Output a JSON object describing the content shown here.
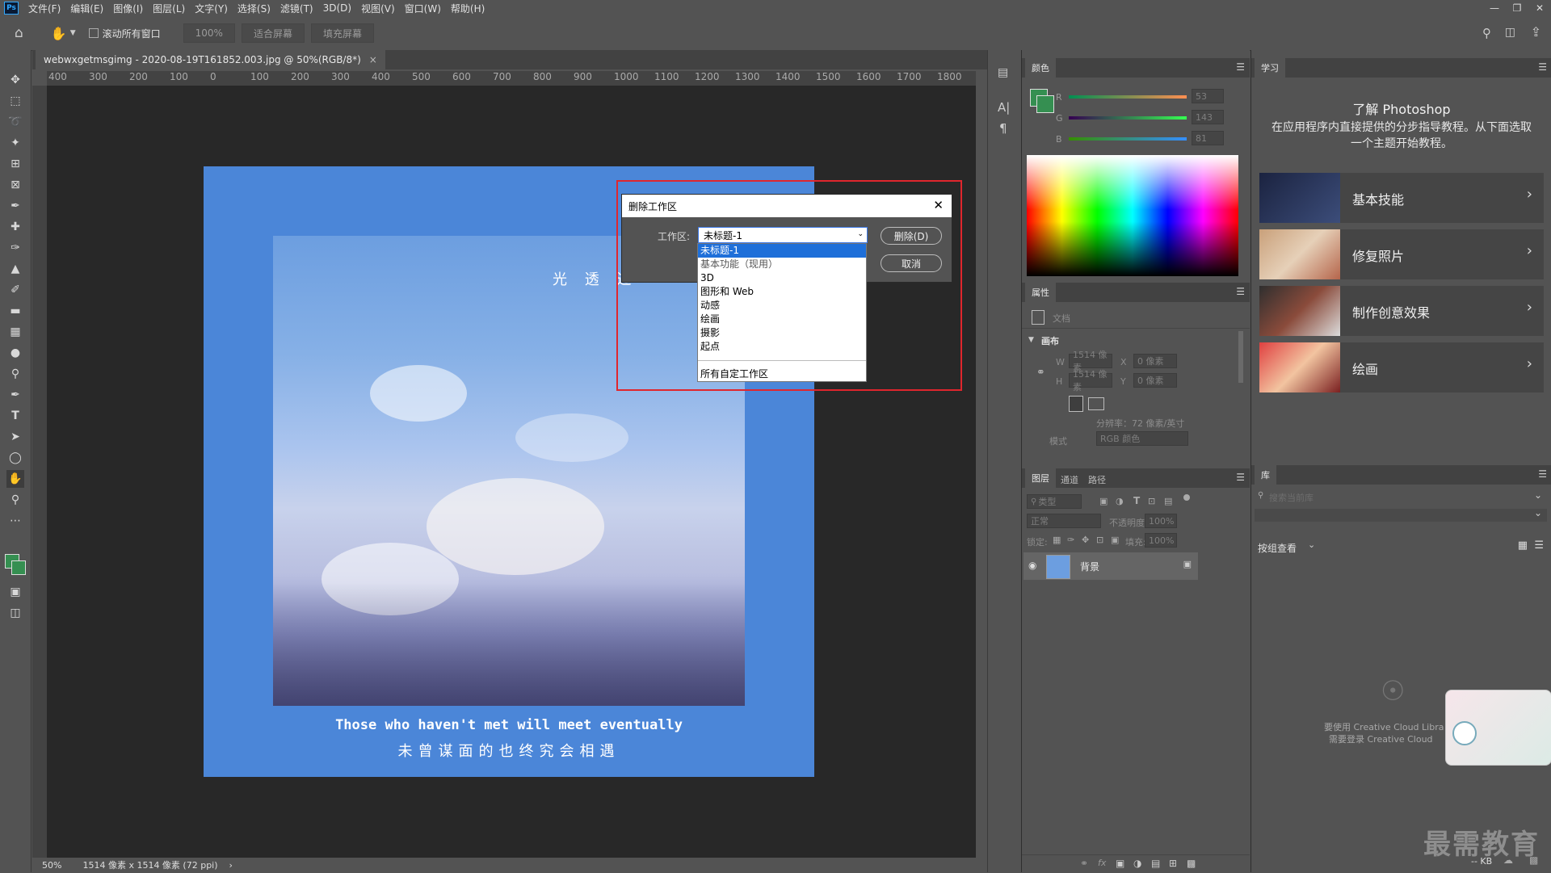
{
  "menu": {
    "items": [
      "文件(F)",
      "编辑(E)",
      "图像(I)",
      "图层(L)",
      "文字(Y)",
      "选择(S)",
      "滤镜(T)",
      "3D(D)",
      "视图(V)",
      "窗口(W)",
      "帮助(H)"
    ]
  },
  "app": {
    "logo": "Ps"
  },
  "options": {
    "scroll_all": "滚动所有窗口",
    "zoom_100": "100%",
    "fit_screen": "适合屏幕",
    "fill_screen": "填充屏幕"
  },
  "document": {
    "tab_title": "webwxgetmsgimg - 2020-08-19T161852.003.jpg @ 50%(RGB/8*)",
    "tab_close": "×"
  },
  "ruler": {
    "h_ticks": [
      "400",
      "300",
      "200",
      "100",
      "0",
      "100",
      "200",
      "300",
      "400",
      "500",
      "600",
      "700",
      "800",
      "900",
      "1000",
      "1100",
      "1200",
      "1300",
      "1400",
      "1500",
      "1600",
      "1700",
      "1800"
    ]
  },
  "poster": {
    "title": "光 透 过",
    "quote_en": "Those who haven't met will meet eventually",
    "quote_cn": "未曾谋面的也终究会相遇"
  },
  "dialog": {
    "title": "删除工作区",
    "label": "工作区:",
    "selected": "未标题-1",
    "delete_label": "删除(D)",
    "cancel_label": "取消",
    "options": [
      "未标题-1",
      "基本功能（现用）",
      "3D",
      "图形和 Web",
      "动感",
      "绘画",
      "摄影",
      "起点",
      "所有自定工作区"
    ]
  },
  "status": {
    "zoom": "50%",
    "doc_info": "1514 像素 x 1514 像素 (72 ppi)",
    "arrow": "›"
  },
  "color_panel": {
    "title": "颜色",
    "channels": [
      {
        "name": "R",
        "value": "53"
      },
      {
        "name": "G",
        "value": "143"
      },
      {
        "name": "B",
        "value": "81"
      }
    ],
    "fg_color": "#358f51"
  },
  "properties": {
    "title": "属性",
    "doc_label": "文档",
    "section": "画布",
    "w_label": "W",
    "w_value": "1514 像素",
    "h_label": "H",
    "h_value": "1514 像素",
    "x_label": "X",
    "x_value": "0 像素",
    "y_label": "Y",
    "y_value": "0 像素",
    "resolution": "分辨率：72 像素/英寸",
    "mode_label": "模式",
    "mode_value": "RGB 颜色"
  },
  "layers": {
    "tabs": [
      "图层",
      "通道",
      "路径"
    ],
    "filter_placeholder": "类型",
    "blend": "正常",
    "opacity_label": "不透明度:",
    "opacity_value": "100%",
    "lock_label": "锁定:",
    "fill_label": "填充:",
    "fill_value": "100%",
    "layer_name": "背景"
  },
  "learn": {
    "title": "学习",
    "heading": "了解 Photoshop",
    "desc": "在应用程序内直接提供的分步指导教程。从下面选取一个主题开始教程。",
    "cards": [
      "基本技能",
      "修复照片",
      "制作创意效果",
      "绘画"
    ]
  },
  "library": {
    "title": "库",
    "search_placeholder": "搜索当前库",
    "group_label": "按组查看",
    "cc_msg1": "要使用 Creative Cloud Libra",
    "cc_msg2": "需要登录 Creative Cloud",
    "kb": "-- KB"
  },
  "watermark": "最需教育"
}
